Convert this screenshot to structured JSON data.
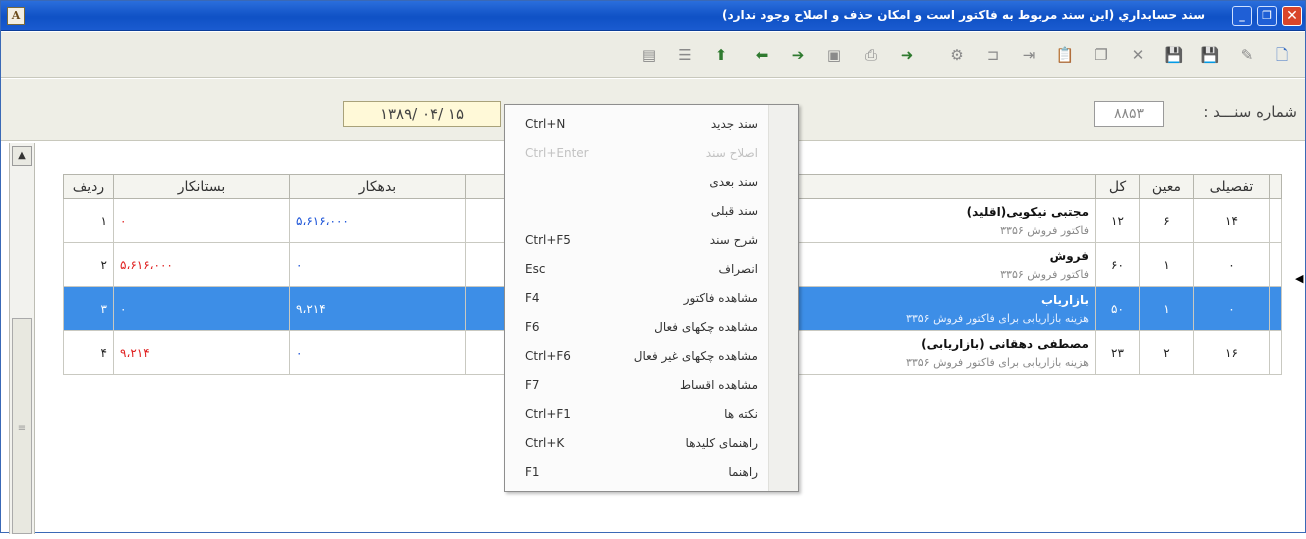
{
  "window": {
    "title": "سند حسابداري (اين سند مربوط به فاكتور است و امكان حذف و اصلاح وجود ندارد)",
    "icon": "app-icon"
  },
  "toolbar": {
    "icons": [
      "new-document-icon",
      "edit-pencil-icon",
      "save-icon",
      "save-as-icon",
      "delete-icon",
      "copy-icon",
      "paste-icon",
      "insert-row-icon",
      "indent-icon",
      "calculator-icon",
      "forward-doc-icon",
      "print-icon",
      "preview-icon",
      "next-icon",
      "previous-icon",
      "export-icon",
      "list-icon",
      "report-icon"
    ]
  },
  "header": {
    "date_value": "۱۳۸۹/ ۰۴/ ۱۵",
    "doc_number_label": "شماره سنـــد :",
    "doc_number_value": "۸۸۵۳"
  },
  "grid": {
    "columns": {
      "radif": "ردیف",
      "bestankar": "بستانکار",
      "bedehkar": "بدهکار",
      "kol": "کل",
      "moin": "معین",
      "tafsili": "تفصیلی"
    },
    "rows": [
      {
        "radif": "۱",
        "bestankar": "۰",
        "bedehkar": "۵،۶۱۶،۰۰۰",
        "title": "مجتبی نیکویی(اقلید)",
        "desc": "فاكتور فروش ۳۳۵۶",
        "kol": "۱۲",
        "moin": "۶",
        "tafsili": "۱۴"
      },
      {
        "radif": "۲",
        "bestankar": "۵،۶۱۶،۰۰۰",
        "bedehkar": "۰",
        "title": "فروش",
        "desc": "فاكتور فروش ۳۳۵۶",
        "kol": "۶۰",
        "moin": "۱",
        "tafsili": "۰"
      },
      {
        "radif": "۳",
        "bestankar": "۰",
        "bedehkar": "۹،۲۱۴",
        "title": "بازاریاب",
        "desc": "هزینه بازاریابی برای فاكتور فروش ۳۳۵۶",
        "kol": "۵۰",
        "moin": "۱",
        "tafsili": "۰"
      },
      {
        "radif": "۴",
        "bestankar": "۹،۲۱۴",
        "bedehkar": "۰",
        "title": "مصطفی دهقانی (بازاریابی)",
        "desc": "هزینه بازاریابی برای فاكتور فروش ۳۳۵۶",
        "kol": "۲۳",
        "moin": "۲",
        "tafsili": "۱۶"
      }
    ]
  },
  "context_menu": {
    "items": [
      {
        "label": "سند جدید",
        "shortcut": "Ctrl+N",
        "enabled": true
      },
      {
        "label": "اصلاح سند",
        "shortcut": "Ctrl+Enter",
        "enabled": false
      },
      {
        "label": "سند بعدی",
        "shortcut": "",
        "enabled": true
      },
      {
        "label": "سند قبلی",
        "shortcut": "",
        "enabled": true
      },
      {
        "label": "شرح سند",
        "shortcut": "Ctrl+F5",
        "enabled": true
      },
      {
        "label": "انصراف",
        "shortcut": "Esc",
        "enabled": true
      },
      {
        "label": "مشاهده فاكتور",
        "shortcut": "F4",
        "enabled": true
      },
      {
        "label": "مشاهده چکهای فعال",
        "shortcut": "F6",
        "enabled": true
      },
      {
        "label": "مشاهده چکهای غیر فعال",
        "shortcut": "Ctrl+F6",
        "enabled": true
      },
      {
        "label": "مشاهده اقساط",
        "shortcut": "F7",
        "enabled": true
      },
      {
        "label": "نکته ها",
        "shortcut": "Ctrl+F1",
        "enabled": true
      },
      {
        "label": "راهنمای کلیدها",
        "shortcut": "Ctrl+K",
        "enabled": true
      },
      {
        "label": "راهنما",
        "shortcut": "F1",
        "enabled": true
      }
    ]
  },
  "colors": {
    "title_bar": "#0f51c5",
    "selected_row": "#3d8ee7",
    "credit_text": "#e02020",
    "debit_text": "#1b53d8",
    "date_field": "#fff9d8"
  }
}
